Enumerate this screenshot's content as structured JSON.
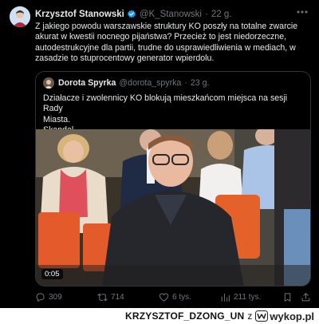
{
  "tweet": {
    "author_name": "Krzysztof Stanowski",
    "handle": "@K_Stanowski",
    "separator": "·",
    "time": "22 g.",
    "text": "Z jakiego powodu warszawskie struktury KO poszły na totalne zwarcie\nakurat w kwestii nocnego pijaństwa? Przecież to jest niedorzeczne,\nautodestrukcyjne dla partii, trudne do usprawiedliwienia w mediach, w\nzasadzie to stuprocentowy generator wpierdolu.",
    "verified_color": "#1d9bf0"
  },
  "quote": {
    "author_name": "Dorota Spyrka",
    "handle": "@dorota_spyrka",
    "separator": "·",
    "time": "23 g.",
    "text": "Działacze i zwolennicy KO blokują mieszkańcom miejsca na sesji Rady\nMiasta.\nSkandal",
    "video_duration": "0:05"
  },
  "actions": {
    "replies": "309",
    "reposts": "714",
    "likes": "6 tys.",
    "views": "211 tys."
  },
  "watermark": {
    "user": "KRZYSZTOF_DZONG_UN",
    "connector": "z",
    "site": "wykop.pl"
  },
  "icons": {
    "more": "more-icon",
    "reply": "reply-icon",
    "repost": "repost-icon",
    "like": "heart-icon",
    "views": "views-icon",
    "bookmark": "bookmark-icon",
    "share": "share-icon"
  }
}
